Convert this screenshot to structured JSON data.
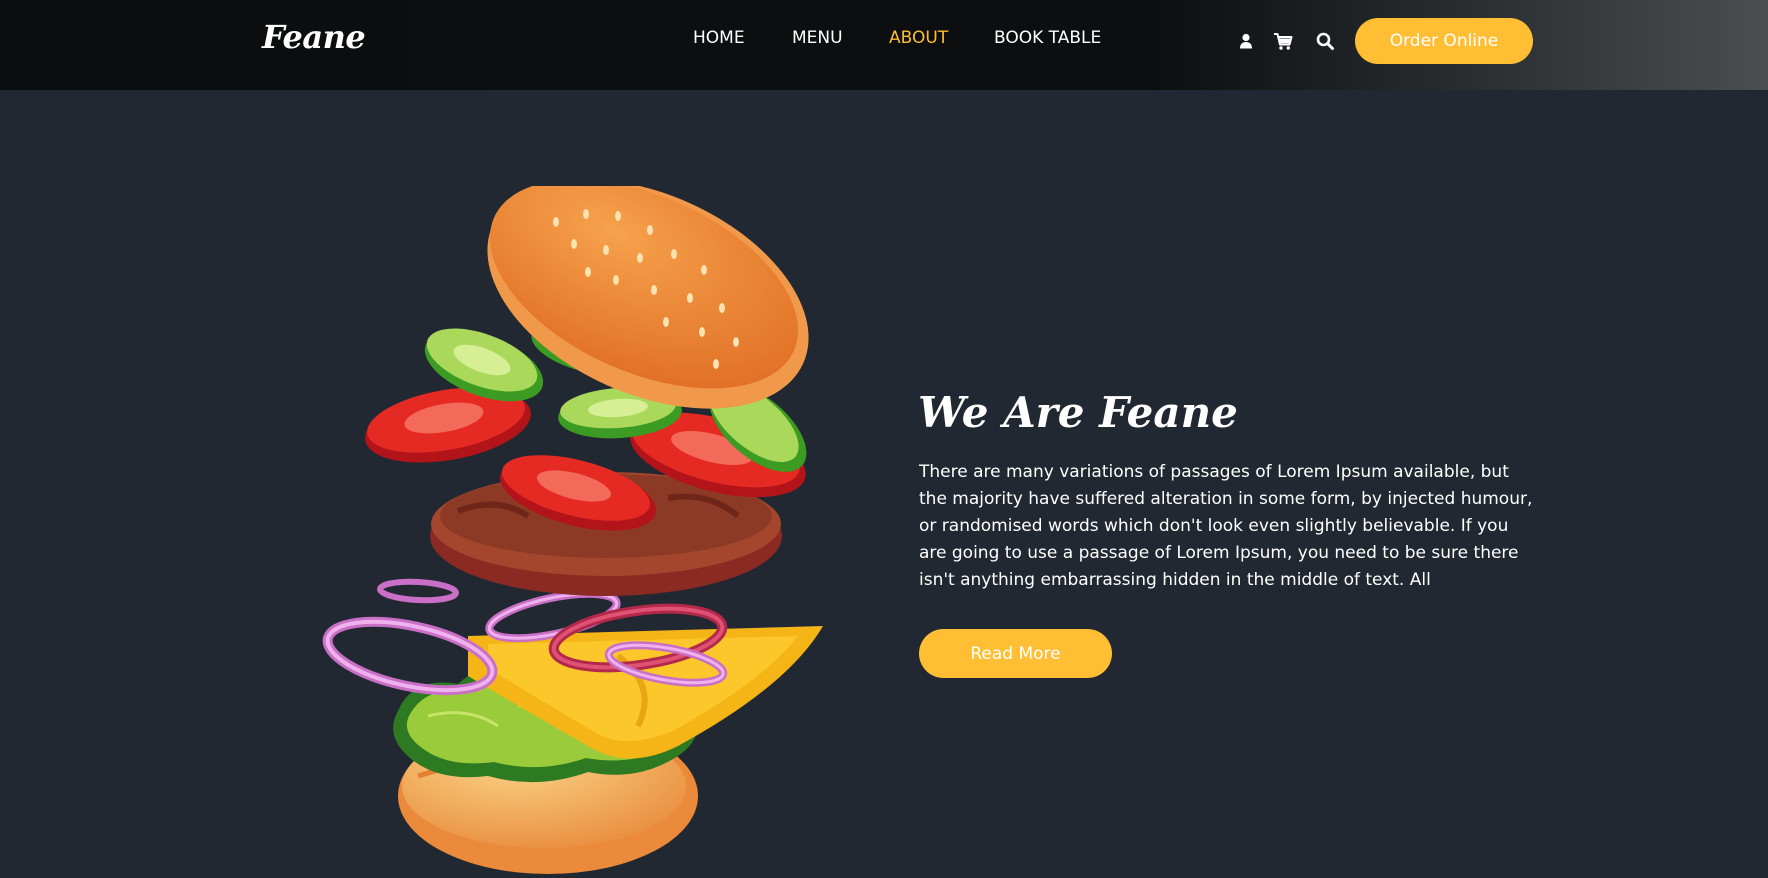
{
  "brand": "Feane",
  "nav": {
    "home": "HOME",
    "menu": "MENU",
    "about": "ABOUT",
    "book_table": "BOOK TABLE",
    "active": "about"
  },
  "header_icons": [
    "user-icon",
    "cart-icon",
    "search-icon"
  ],
  "order_button": "Order Online",
  "about": {
    "title": "We Are Feane",
    "text": "There are many variations of passages of Lorem Ipsum available, but the majority have suffered alteration in some form, by injected humour, or randomised words which don't look even slightly believable. If you are going to use a passage of Lorem Ipsum, you need to be sure there isn't anything embarrassing hidden in the middle of text. All",
    "button": "Read More",
    "illustration": "burger-illustration"
  },
  "colors": {
    "accent": "#ffbe33",
    "background": "#222831",
    "header": "#0c0e10",
    "text": "#ffffff"
  }
}
